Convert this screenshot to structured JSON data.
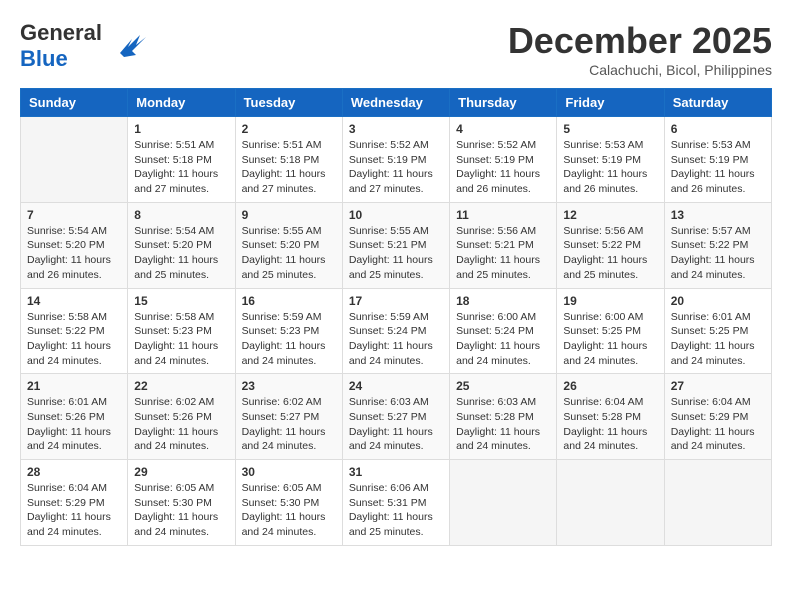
{
  "header": {
    "logo_general": "General",
    "logo_blue": "Blue",
    "month_title": "December 2025",
    "location": "Calachuchi, Bicol, Philippines"
  },
  "weekdays": [
    "Sunday",
    "Monday",
    "Tuesday",
    "Wednesday",
    "Thursday",
    "Friday",
    "Saturday"
  ],
  "weeks": [
    [
      {
        "day": "",
        "info": ""
      },
      {
        "day": "1",
        "info": "Sunrise: 5:51 AM\nSunset: 5:18 PM\nDaylight: 11 hours\nand 27 minutes."
      },
      {
        "day": "2",
        "info": "Sunrise: 5:51 AM\nSunset: 5:18 PM\nDaylight: 11 hours\nand 27 minutes."
      },
      {
        "day": "3",
        "info": "Sunrise: 5:52 AM\nSunset: 5:19 PM\nDaylight: 11 hours\nand 27 minutes."
      },
      {
        "day": "4",
        "info": "Sunrise: 5:52 AM\nSunset: 5:19 PM\nDaylight: 11 hours\nand 26 minutes."
      },
      {
        "day": "5",
        "info": "Sunrise: 5:53 AM\nSunset: 5:19 PM\nDaylight: 11 hours\nand 26 minutes."
      },
      {
        "day": "6",
        "info": "Sunrise: 5:53 AM\nSunset: 5:19 PM\nDaylight: 11 hours\nand 26 minutes."
      }
    ],
    [
      {
        "day": "7",
        "info": "Sunrise: 5:54 AM\nSunset: 5:20 PM\nDaylight: 11 hours\nand 26 minutes."
      },
      {
        "day": "8",
        "info": "Sunrise: 5:54 AM\nSunset: 5:20 PM\nDaylight: 11 hours\nand 25 minutes."
      },
      {
        "day": "9",
        "info": "Sunrise: 5:55 AM\nSunset: 5:20 PM\nDaylight: 11 hours\nand 25 minutes."
      },
      {
        "day": "10",
        "info": "Sunrise: 5:55 AM\nSunset: 5:21 PM\nDaylight: 11 hours\nand 25 minutes."
      },
      {
        "day": "11",
        "info": "Sunrise: 5:56 AM\nSunset: 5:21 PM\nDaylight: 11 hours\nand 25 minutes."
      },
      {
        "day": "12",
        "info": "Sunrise: 5:56 AM\nSunset: 5:22 PM\nDaylight: 11 hours\nand 25 minutes."
      },
      {
        "day": "13",
        "info": "Sunrise: 5:57 AM\nSunset: 5:22 PM\nDaylight: 11 hours\nand 24 minutes."
      }
    ],
    [
      {
        "day": "14",
        "info": "Sunrise: 5:58 AM\nSunset: 5:22 PM\nDaylight: 11 hours\nand 24 minutes."
      },
      {
        "day": "15",
        "info": "Sunrise: 5:58 AM\nSunset: 5:23 PM\nDaylight: 11 hours\nand 24 minutes."
      },
      {
        "day": "16",
        "info": "Sunrise: 5:59 AM\nSunset: 5:23 PM\nDaylight: 11 hours\nand 24 minutes."
      },
      {
        "day": "17",
        "info": "Sunrise: 5:59 AM\nSunset: 5:24 PM\nDaylight: 11 hours\nand 24 minutes."
      },
      {
        "day": "18",
        "info": "Sunrise: 6:00 AM\nSunset: 5:24 PM\nDaylight: 11 hours\nand 24 minutes."
      },
      {
        "day": "19",
        "info": "Sunrise: 6:00 AM\nSunset: 5:25 PM\nDaylight: 11 hours\nand 24 minutes."
      },
      {
        "day": "20",
        "info": "Sunrise: 6:01 AM\nSunset: 5:25 PM\nDaylight: 11 hours\nand 24 minutes."
      }
    ],
    [
      {
        "day": "21",
        "info": "Sunrise: 6:01 AM\nSunset: 5:26 PM\nDaylight: 11 hours\nand 24 minutes."
      },
      {
        "day": "22",
        "info": "Sunrise: 6:02 AM\nSunset: 5:26 PM\nDaylight: 11 hours\nand 24 minutes."
      },
      {
        "day": "23",
        "info": "Sunrise: 6:02 AM\nSunset: 5:27 PM\nDaylight: 11 hours\nand 24 minutes."
      },
      {
        "day": "24",
        "info": "Sunrise: 6:03 AM\nSunset: 5:27 PM\nDaylight: 11 hours\nand 24 minutes."
      },
      {
        "day": "25",
        "info": "Sunrise: 6:03 AM\nSunset: 5:28 PM\nDaylight: 11 hours\nand 24 minutes."
      },
      {
        "day": "26",
        "info": "Sunrise: 6:04 AM\nSunset: 5:28 PM\nDaylight: 11 hours\nand 24 minutes."
      },
      {
        "day": "27",
        "info": "Sunrise: 6:04 AM\nSunset: 5:29 PM\nDaylight: 11 hours\nand 24 minutes."
      }
    ],
    [
      {
        "day": "28",
        "info": "Sunrise: 6:04 AM\nSunset: 5:29 PM\nDaylight: 11 hours\nand 24 minutes."
      },
      {
        "day": "29",
        "info": "Sunrise: 6:05 AM\nSunset: 5:30 PM\nDaylight: 11 hours\nand 24 minutes."
      },
      {
        "day": "30",
        "info": "Sunrise: 6:05 AM\nSunset: 5:30 PM\nDaylight: 11 hours\nand 24 minutes."
      },
      {
        "day": "31",
        "info": "Sunrise: 6:06 AM\nSunset: 5:31 PM\nDaylight: 11 hours\nand 25 minutes."
      },
      {
        "day": "",
        "info": ""
      },
      {
        "day": "",
        "info": ""
      },
      {
        "day": "",
        "info": ""
      }
    ]
  ]
}
